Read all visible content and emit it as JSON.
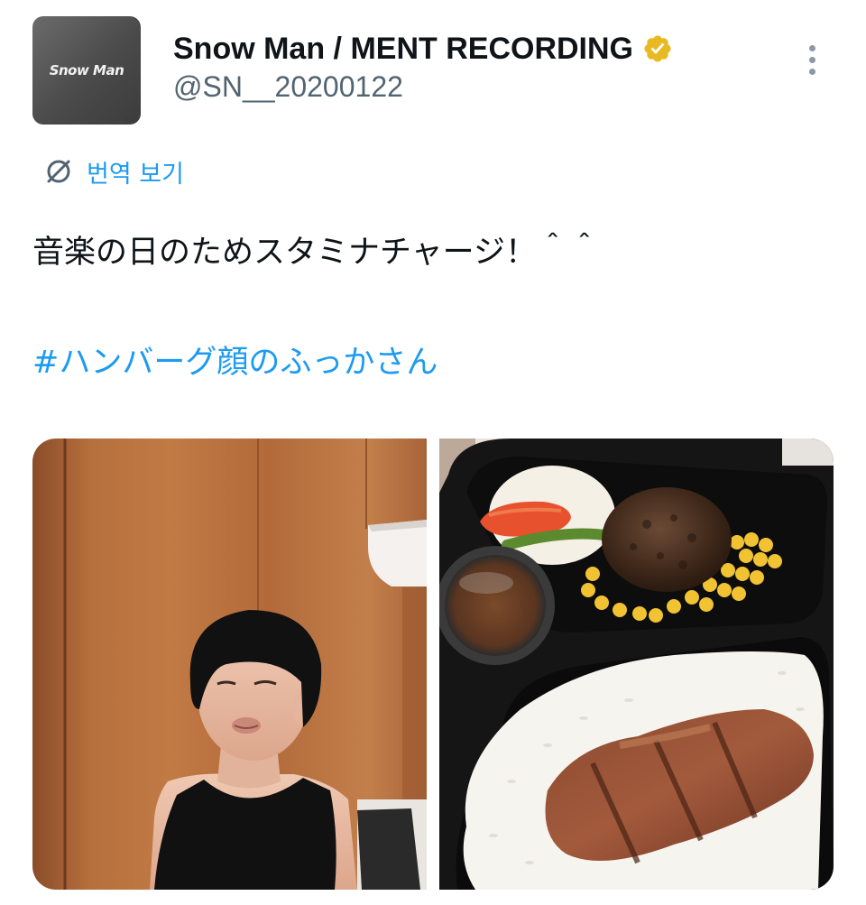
{
  "author": {
    "display_name": "Snow Man / MENT RECORDING",
    "handle": "@SN__20200122",
    "avatar_text": "Snow Man",
    "verified_icon": "verified-badge-gold",
    "verified_color": "#e8b923"
  },
  "translate": {
    "label": "번역 보기",
    "icon": "translate-globe-icon"
  },
  "tweet": {
    "text": "音楽の日のためスタミナチャージ！＾＾",
    "hashtag": "#ハンバーグ顔のふっかさん"
  },
  "colors": {
    "link": "#1d9bf0",
    "secondary": "#536471",
    "text": "#0f1419"
  },
  "media": [
    {
      "description_icon": "photo-man-pouting"
    },
    {
      "description_icon": "photo-hamburg-bento"
    }
  ]
}
